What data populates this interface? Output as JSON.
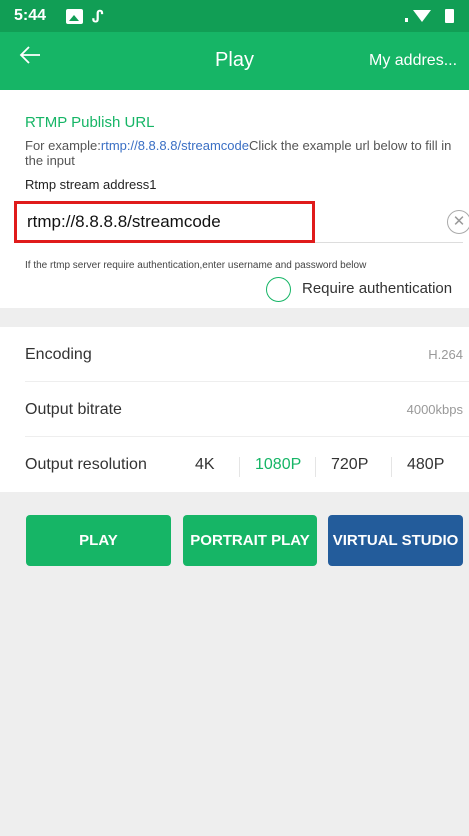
{
  "status_bar": {
    "time": "5:44",
    "icons": [
      "image-icon",
      "cast-icon",
      "signal-icon",
      "wifi-icon",
      "battery-icon"
    ]
  },
  "app_bar": {
    "back_icon": "back-arrow-icon",
    "title": "Play",
    "right_action": "My addres..."
  },
  "rtmp": {
    "section_title": "RTMP Publish URL",
    "example_prefix": "For example:",
    "example_url": "rtmp://8.8.8.8/streamcode",
    "example_suffix": "Click the example url below to fill in the input",
    "address_label": "Rtmp stream address1",
    "url_value": "rtmp://8.8.8.8/streamcode",
    "clear_icon": "clear-circle-icon",
    "auth_hint": "If the rtmp server require authentication,enter username and password below",
    "auth_checkbox_label": "Require authentication",
    "auth_checked": false
  },
  "settings": {
    "encoding": {
      "label": "Encoding",
      "value": "H.264"
    },
    "bitrate": {
      "label": "Output bitrate",
      "value": "4000kbps"
    },
    "resolution": {
      "label": "Output resolution",
      "options": [
        "4K",
        "1080P",
        "720P",
        "480P"
      ],
      "selected": "1080P"
    }
  },
  "buttons": {
    "play": "PLAY",
    "portrait_play": "PORTRAIT PLAY",
    "virtual_studio": "VIRTUAL STUDIO"
  },
  "colors": {
    "primary_green": "#16b566",
    "status_green": "#119e55",
    "studio_blue": "#235c9b",
    "highlight_red": "#e01b1b",
    "link_blue": "#3a6fc4"
  }
}
